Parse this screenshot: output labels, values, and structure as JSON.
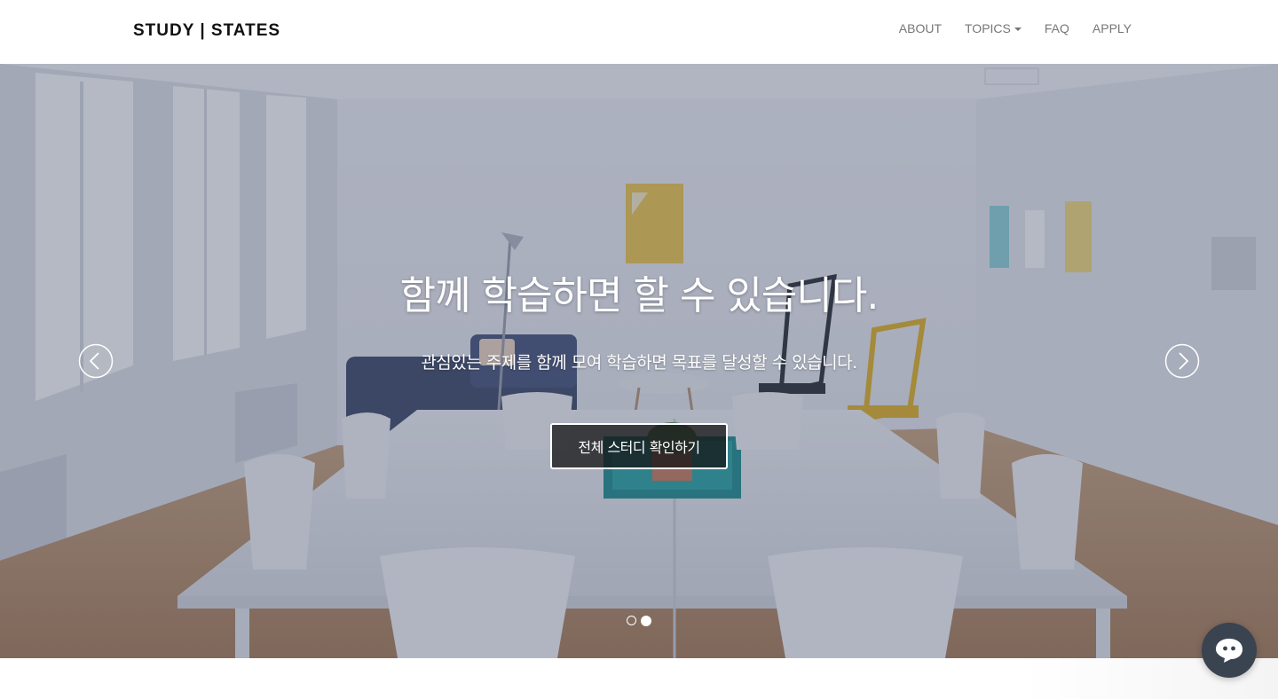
{
  "navbar": {
    "brand": "STUDY | STATES",
    "links": [
      "ABOUT",
      "TOPICS",
      "FAQ",
      "APPLY"
    ]
  },
  "hero": {
    "headline": "함께 학습하면 할 수 있습니다.",
    "subline": "관심있는 주제를 함께 모여 학습하면 목표를 달성할 수 있습니다.",
    "cta_label": "전체 스터디 확인하기",
    "slide_count": 2,
    "active_slide_index": 1
  },
  "icons": {
    "prev": "chevron-left-circle-icon",
    "next": "chevron-right-circle-icon",
    "dropdown": "caret-down-icon",
    "chat": "chat-bubble-icon"
  },
  "colors": {
    "nav_text": "#777777",
    "brand_text": "#111111",
    "cta_background": "#141414",
    "chat_button": "#3a4350"
  }
}
